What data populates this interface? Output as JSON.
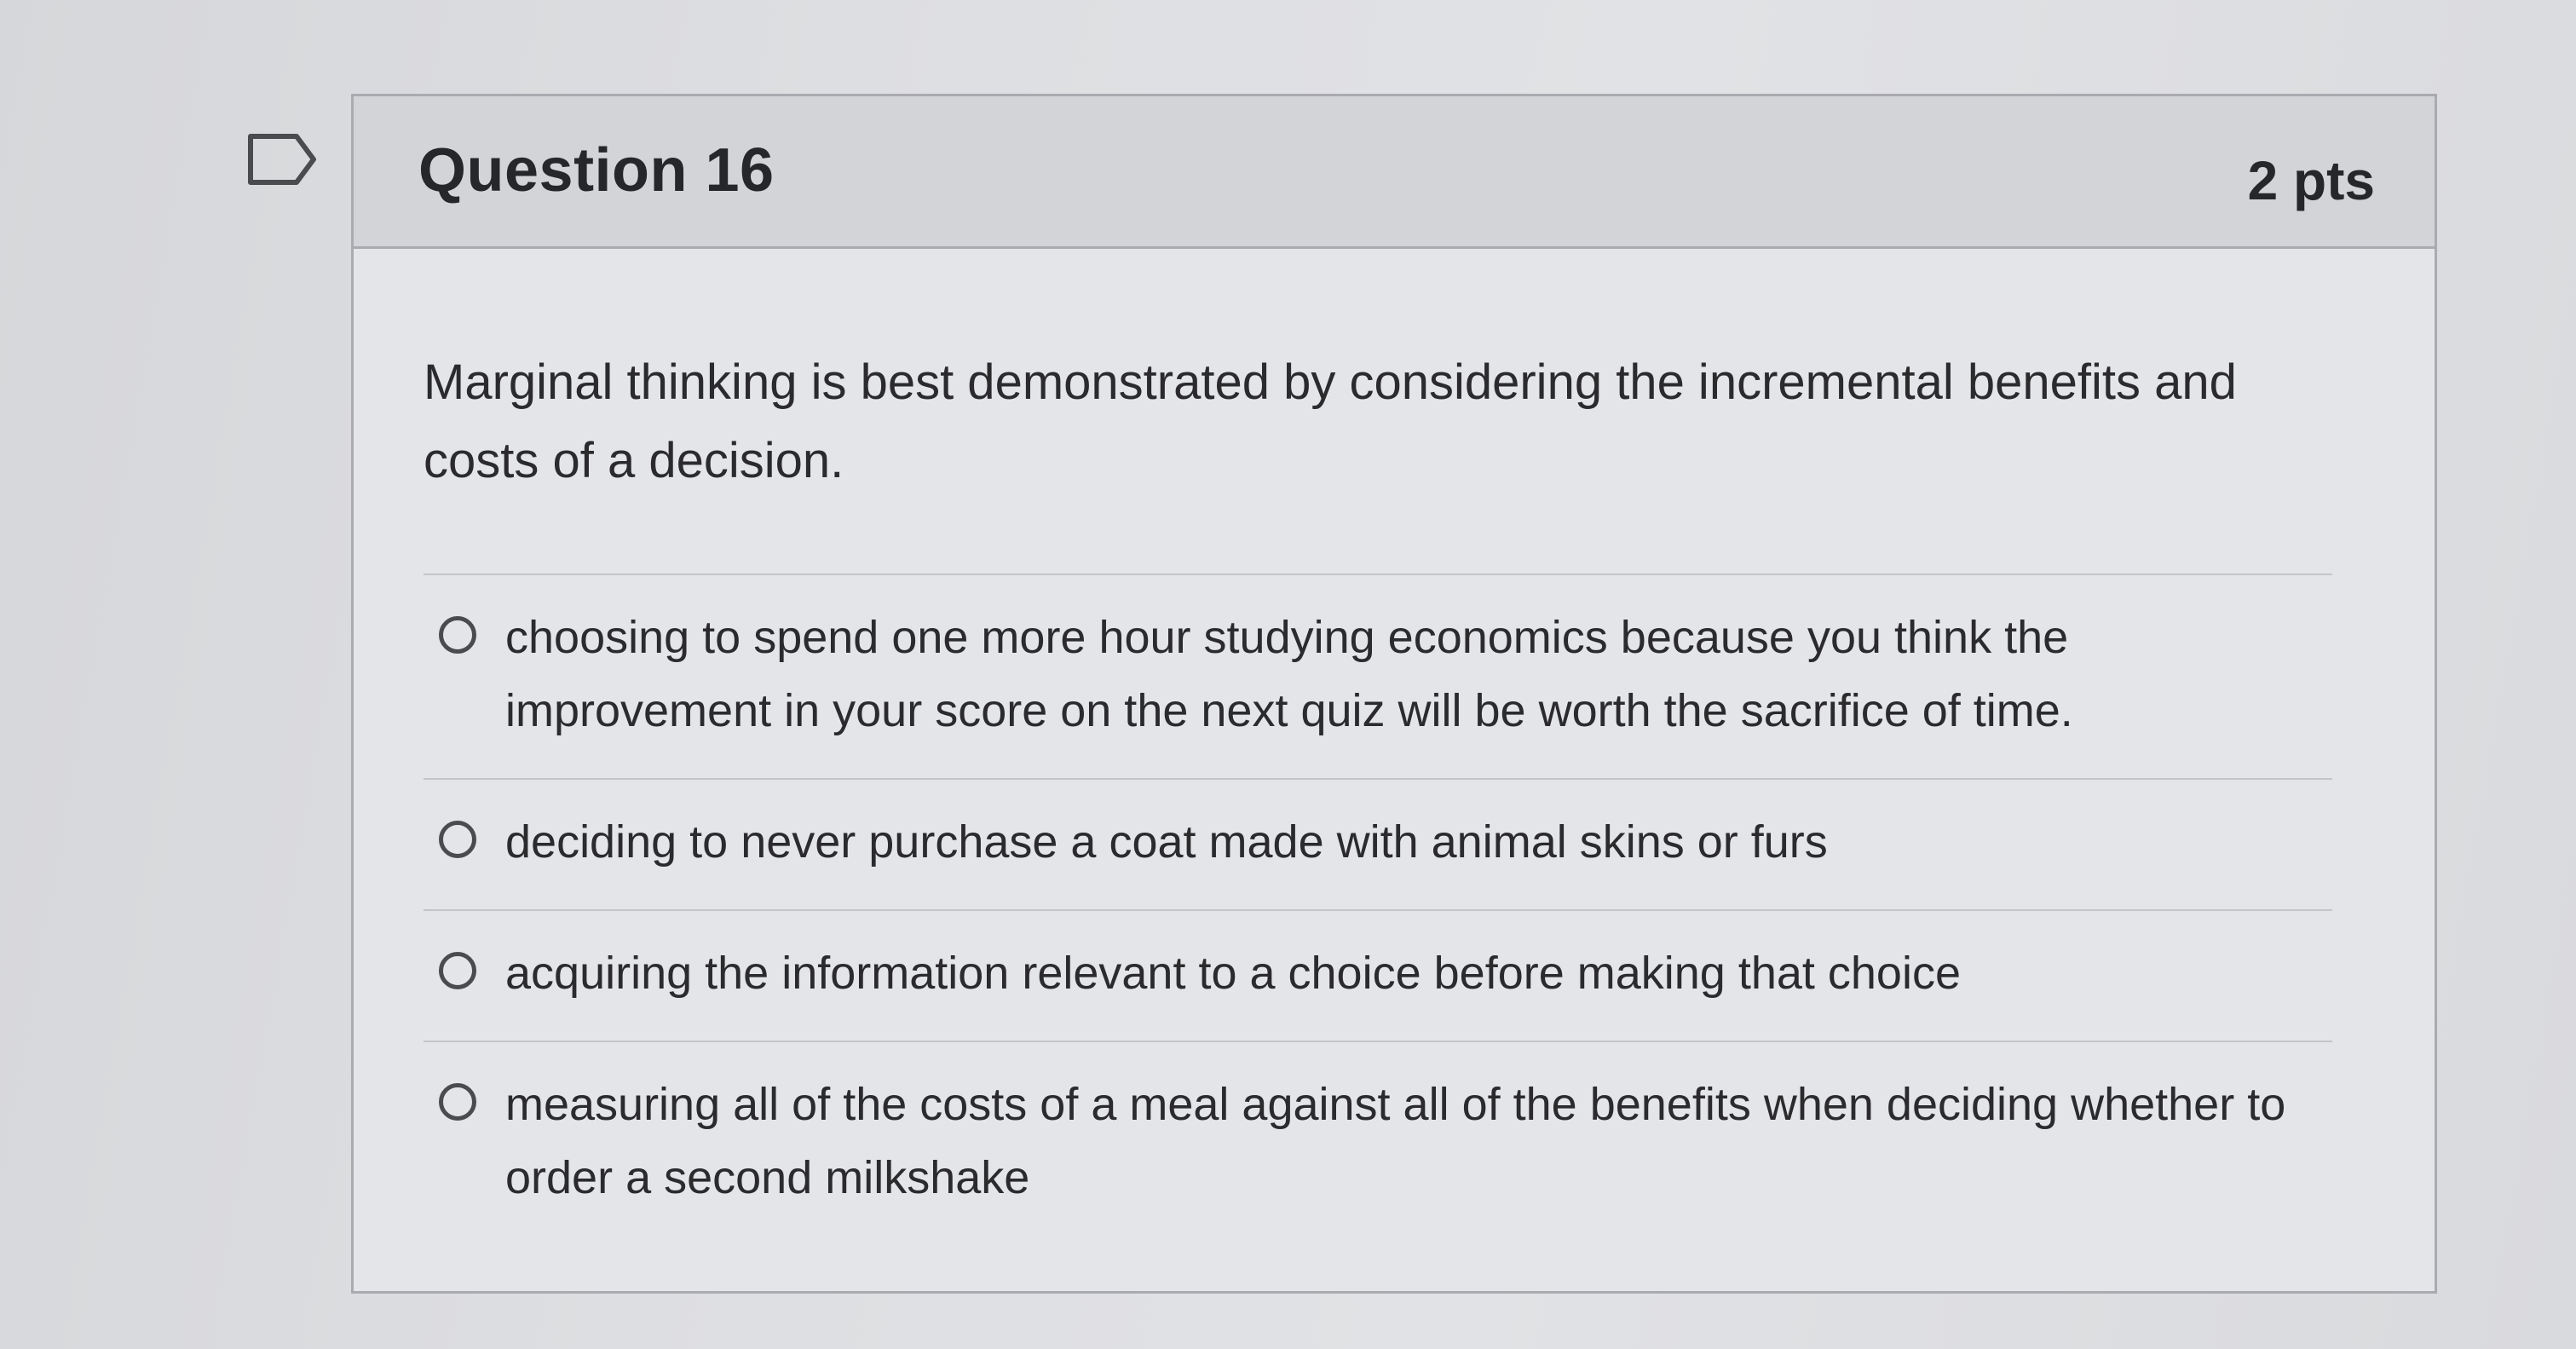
{
  "question": {
    "title": "Question 16",
    "points": "2 pts",
    "text": "Marginal thinking is best demonstrated by considering the incremental benefits and costs of a decision.",
    "flag_icon": "flag-outline-icon",
    "answers": [
      {
        "label": "choosing to spend one more hour studying economics because you think the improvement in your score on the next quiz will be worth the sacrifice of time.",
        "selected": false
      },
      {
        "label": "deciding to never purchase a coat made with animal skins or furs",
        "selected": false
      },
      {
        "label": "acquiring the information relevant to a choice before making that choice",
        "selected": false
      },
      {
        "label": "measuring all of the costs of a meal against all of the benefits when deciding whether to order a second milkshake",
        "selected": false
      }
    ]
  },
  "colors": {
    "background": "#dedfe2",
    "header_background": "#d3d4d8",
    "card_background": "#e4e5e8",
    "border": "#a9abb0",
    "text": "#2b2b2e"
  }
}
